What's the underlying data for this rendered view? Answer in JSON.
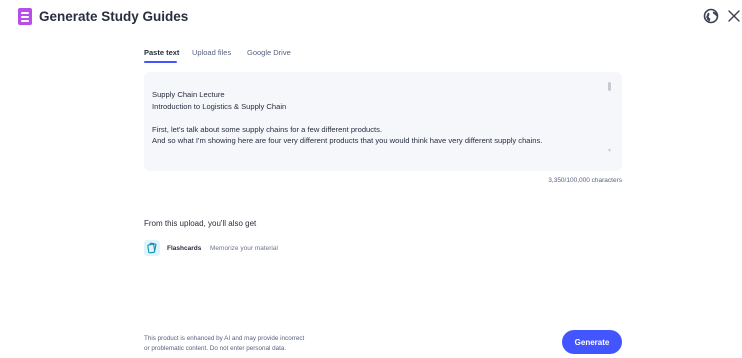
{
  "header": {
    "title": "Generate Study Guides"
  },
  "tabs": [
    {
      "label": "Paste text",
      "active": true
    },
    {
      "label": "Upload files",
      "active": false
    },
    {
      "label": "Google Drive",
      "active": false
    }
  ],
  "editor": {
    "lines": [
      "Supply Chain Lecture",
      "Introduction to Logistics & Supply Chain",
      "",
      "First, let's talk about some supply chains for a few different products.",
      "And so what I'm showing here are four very different products that you would think have very different supply chains."
    ],
    "char_count": "3,350/100,000 characters"
  },
  "upload_section": {
    "title": "From this upload, you'll also get",
    "features": [
      {
        "name": "Flashcards",
        "description": "Memorize your material",
        "icon": "flashcards-icon"
      }
    ]
  },
  "footer": {
    "disclaimer_lines": [
      "This product is enhanced by AI and may provide incorrect",
      "or problematic content. Do not enter personal data."
    ],
    "generate_label": "Generate"
  },
  "icons": {
    "logo": "study-guide-logo-icon",
    "globe": "globe-icon",
    "close": "close-icon"
  },
  "colors": {
    "accent": "#4255ff",
    "logo": "#b84ee6",
    "editor_bg": "#f6f7fb",
    "flashcard_icon_bg": "#e0f5fb"
  }
}
